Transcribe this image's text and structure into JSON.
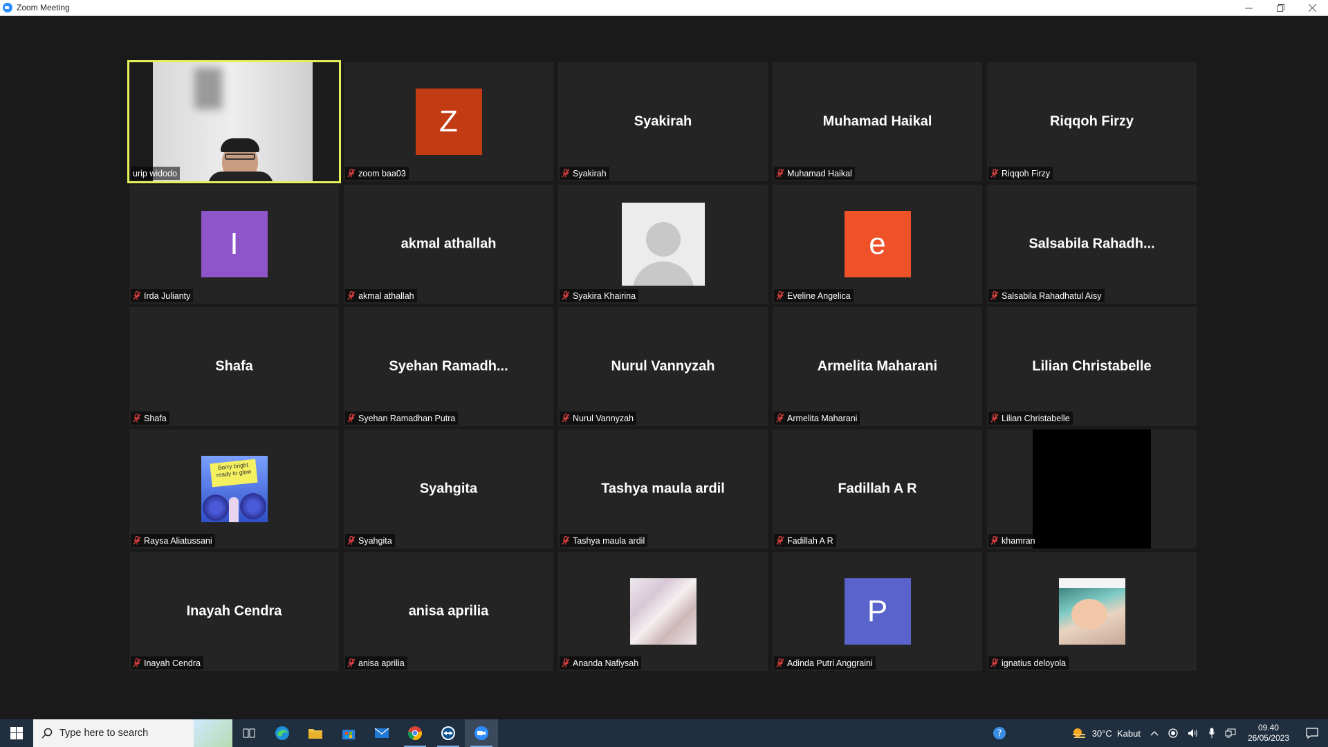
{
  "window": {
    "title": "Zoom Meeting"
  },
  "participants": [
    {
      "tile_name": "",
      "label": "urip widodo",
      "type": "video",
      "active": true,
      "muted": false
    },
    {
      "tile_name": "",
      "label": "zoom baa03",
      "type": "letter",
      "letter": "Z",
      "color": "#c23b12",
      "muted": true
    },
    {
      "tile_name": "Syakirah",
      "label": "Syakirah",
      "type": "name",
      "muted": true
    },
    {
      "tile_name": "Muhamad Haikal",
      "label": "Muhamad Haikal",
      "type": "name",
      "muted": true
    },
    {
      "tile_name": "Riqqoh Firzy",
      "label": "Riqqoh Firzy",
      "type": "name",
      "muted": true
    },
    {
      "tile_name": "",
      "label": "Irda Julianty",
      "type": "letter",
      "letter": "I",
      "color": "#8e54c9",
      "muted": true
    },
    {
      "tile_name": "akmal athallah",
      "label": "akmal athallah",
      "type": "name",
      "muted": true
    },
    {
      "tile_name": "",
      "label": "Syakira Khairina",
      "type": "default-avatar",
      "muted": true
    },
    {
      "tile_name": "",
      "label": "Eveline Angelica",
      "type": "letter",
      "letter": "e",
      "color": "#ef5128",
      "muted": true
    },
    {
      "tile_name": "Salsabila  Rahadh...",
      "label": "Salsabila Rahadhatul Aisy",
      "type": "name",
      "muted": true
    },
    {
      "tile_name": "Shafa",
      "label": "Shafa",
      "type": "name",
      "muted": true
    },
    {
      "tile_name": "Syehan  Ramadh...",
      "label": "Syehan Ramadhan Putra",
      "type": "name",
      "muted": true
    },
    {
      "tile_name": "Nurul Vannyzah",
      "label": "Nurul Vannyzah",
      "type": "name",
      "muted": true
    },
    {
      "tile_name": "Armelita Maharani",
      "label": "Armelita Maharani",
      "type": "name",
      "muted": true
    },
    {
      "tile_name": "Lilian Christabelle",
      "label": "Lilian Christabelle",
      "type": "name",
      "muted": true
    },
    {
      "tile_name": "",
      "label": "Raysa Aliatussani",
      "type": "photo-berry",
      "photo_text": "Berry bright ready to glow",
      "muted": true
    },
    {
      "tile_name": "Syahgita",
      "label": "Syahgita",
      "type": "name",
      "muted": true
    },
    {
      "tile_name": "Tashya maula ardil",
      "label": "Tashya maula ardil",
      "type": "name",
      "muted": true
    },
    {
      "tile_name": "Fadillah A R",
      "label": "Fadillah A R",
      "type": "name",
      "muted": true
    },
    {
      "tile_name": "",
      "label": "khamran",
      "type": "black-video",
      "muted": true
    },
    {
      "tile_name": "Inayah Cendra",
      "label": "Inayah Cendra",
      "type": "name",
      "muted": true
    },
    {
      "tile_name": "anisa aprilia",
      "label": "anisa aprilia",
      "type": "name",
      "muted": true
    },
    {
      "tile_name": "",
      "label": "Ananda Nafiysah",
      "type": "photo-marble",
      "muted": true
    },
    {
      "tile_name": "",
      "label": "Adinda Putri Anggraini",
      "type": "letter",
      "letter": "P",
      "color": "#5a63cc",
      "muted": true
    },
    {
      "tile_name": "",
      "label": "ignatius deloyola",
      "type": "photo-baby",
      "muted": true
    }
  ],
  "taskbar": {
    "search_placeholder": "Type here to search",
    "weather": "30°C  Kabut",
    "time": "09.40",
    "date": "26/05/2023"
  }
}
